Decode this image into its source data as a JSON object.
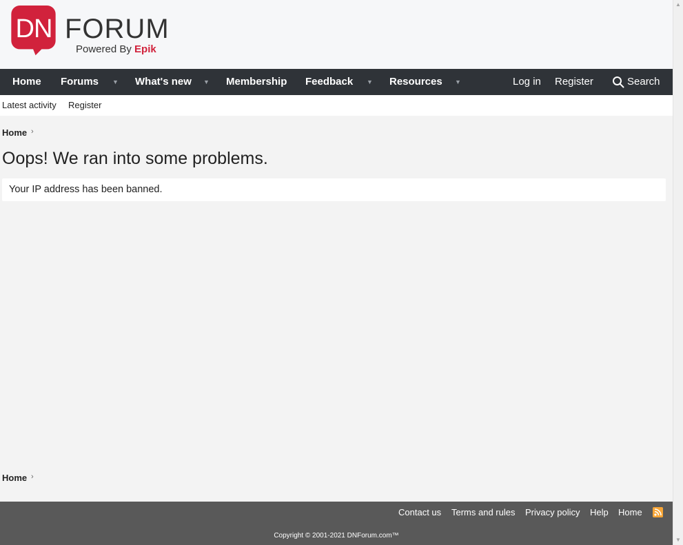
{
  "header": {
    "logo_dn": "DN",
    "logo_forum": "FORUM",
    "logo_powered": "Powered By",
    "logo_epik": "Epik"
  },
  "nav": {
    "home": "Home",
    "forums": "Forums",
    "whats_new": "What's new",
    "membership": "Membership",
    "feedback": "Feedback",
    "resources": "Resources",
    "login": "Log in",
    "register": "Register",
    "search": "Search",
    "caret": "▼"
  },
  "subnav": {
    "latest_activity": "Latest activity",
    "register": "Register"
  },
  "breadcrumb": {
    "home": "Home",
    "chevron": "›"
  },
  "main": {
    "title": "Oops! We ran into some problems.",
    "message": "Your IP address has been banned."
  },
  "footer": {
    "links": [
      "Contact us",
      "Terms and rules",
      "Privacy policy",
      "Help",
      "Home"
    ],
    "copyright": "Copyright © 2001-2021 DNForum.com™"
  },
  "colors": {
    "brand": "#d1223c",
    "nav_bg": "#2f3338",
    "footer_bg": "#595959",
    "rss": "#f7a536"
  }
}
